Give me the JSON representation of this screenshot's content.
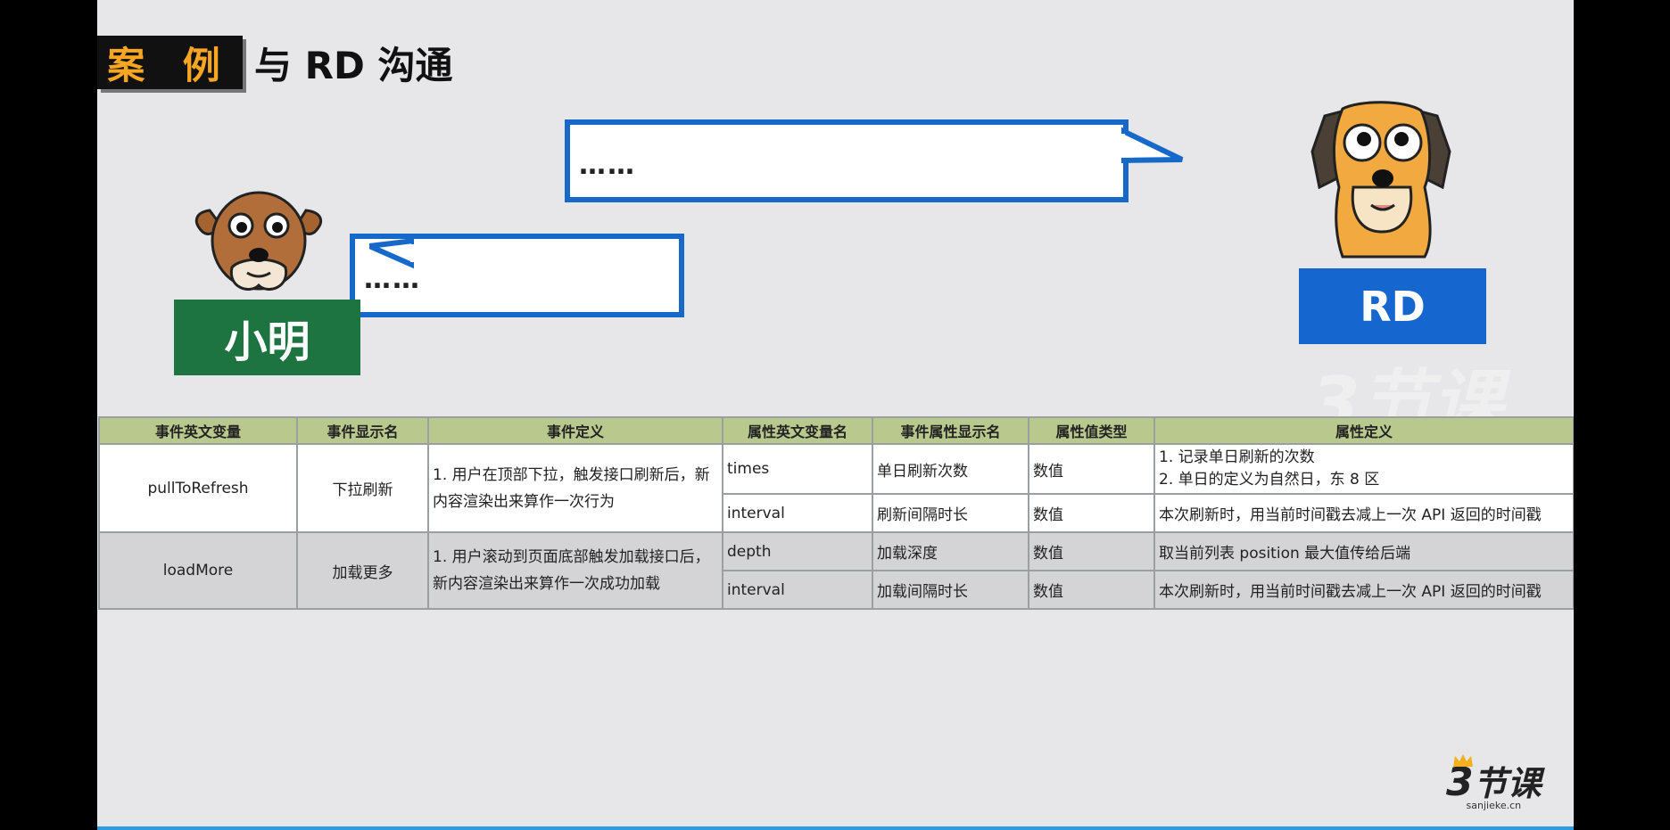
{
  "header": {
    "badge": "案 例",
    "title": "与 RD 沟通"
  },
  "bubbles": {
    "rd_text": "……",
    "xiaoming_text": "……"
  },
  "characters": {
    "xiaoming_label": "小明",
    "rd_label": "RD"
  },
  "colors": {
    "bubble_border": "#1668c9",
    "xiaoming_box": "#1d7440",
    "rd_box": "#1566cf",
    "badge_text": "#f6a623",
    "header_row": "#b9c88d"
  },
  "table": {
    "headers": [
      "事件英文变量",
      "事件显示名",
      "事件定义",
      "属性英文变量名",
      "事件属性显示名",
      "属性值类型",
      "属性定义"
    ],
    "events": [
      {
        "var": "pullToRefresh",
        "name": "下拉刷新",
        "definition": "1. 用户在顶部下拉，触发接口刷新后，新内容渲染出来算作一次行为",
        "props": [
          {
            "var": "times",
            "name": "单日刷新次数",
            "type": "数值",
            "def1": "1. 记录单日刷新的次数",
            "def2": "2. 单日的定义为自然日，东 8 区"
          },
          {
            "var": "interval",
            "name": "刷新间隔时长",
            "type": "数值",
            "def1": "本次刷新时，用当前时间戳去减上一次 API 返回的时间戳"
          }
        ]
      },
      {
        "var": "loadMore",
        "name": "加载更多",
        "definition": "1. 用户滚动到页面底部触发加载接口后，新内容渲染出来算作一次成功加载",
        "props": [
          {
            "var": "depth",
            "name": "加载深度",
            "type": "数值",
            "def1": "取当前列表 position 最大值传给后端"
          },
          {
            "var": "interval",
            "name": "加载间隔时长",
            "type": "数值",
            "def1": "本次刷新时，用当前时间戳去减上一次 API 返回的时间戳"
          }
        ]
      }
    ]
  },
  "watermark": {
    "url": "sanjieke.cn"
  },
  "logo": {
    "digit": "3",
    "chars": "节课",
    "url": "sanjieke.cn"
  }
}
